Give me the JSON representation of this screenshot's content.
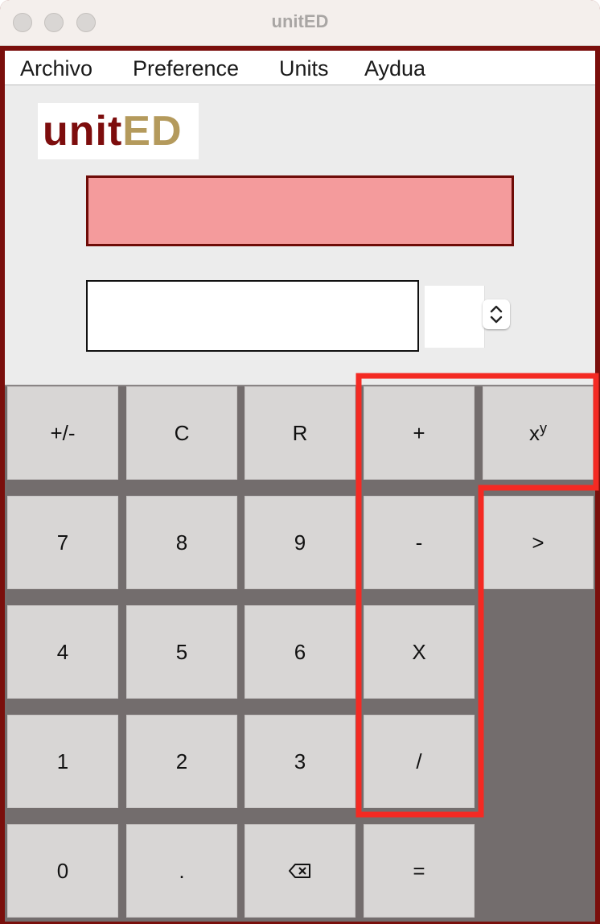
{
  "window": {
    "title": "unitED"
  },
  "menu": [
    "Archivo",
    "Preference",
    "Units",
    "Aydua"
  ],
  "logo": {
    "part1": "unit",
    "part2": "ED",
    "color1": "#7d0d0d",
    "color2": "#b49a5c"
  },
  "display": {
    "value": ""
  },
  "input": {
    "value": "",
    "placeholder": ""
  },
  "unit_select": {
    "selected": "",
    "icon": "up-down-chevron-icon"
  },
  "keys": {
    "plus_minus": "+/-",
    "clear": "C",
    "reset": "R",
    "plus": "+",
    "power_base": "x",
    "power_exp": "y",
    "seven": "7",
    "eight": "8",
    "nine": "9",
    "minus": "-",
    "next": ">",
    "four": "4",
    "five": "5",
    "six": "6",
    "multiply": "X",
    "one": "1",
    "two": "2",
    "three": "3",
    "divide": "/",
    "zero": "0",
    "decimal": ".",
    "backspace_icon": "backspace-icon",
    "equals": "="
  },
  "colors": {
    "window_frame": "#7a0f0c",
    "display_fill": "#f49b9c",
    "keypad_bg": "#736d6d",
    "key_bg": "#d8d6d5",
    "highlight": "#f42a23"
  }
}
